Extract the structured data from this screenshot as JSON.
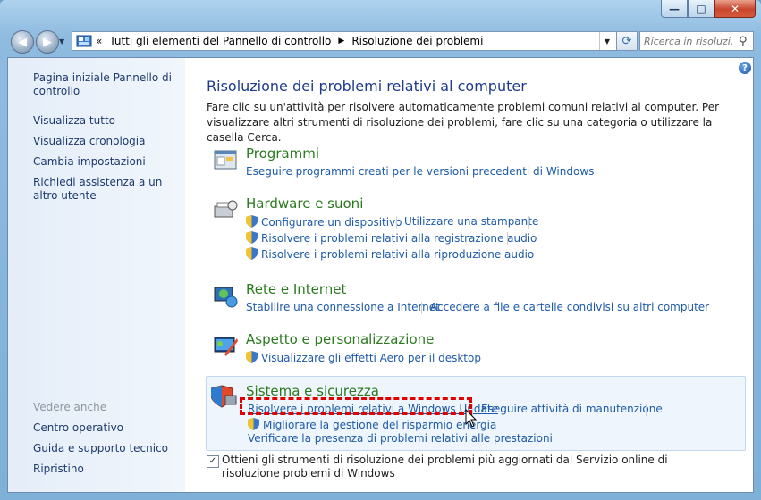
{
  "window": {
    "min_label": "—",
    "max_label": "□",
    "close_label": "✕"
  },
  "address": {
    "root_glyph": "«",
    "crumbs": [
      "Tutti gli elementi del Pannello di controllo",
      "Risoluzione dei problemi"
    ],
    "crumb_sep": "▶"
  },
  "search": {
    "placeholder": "Ricerca in risoluzi..."
  },
  "sidebar": {
    "home": "Pagina iniziale Pannello di controllo",
    "items": [
      "Visualizza tutto",
      "Visualizza cronologia",
      "Cambia impostazioni",
      "Richiedi assistenza a un altro utente"
    ],
    "see_also_header": "Vedere anche",
    "see_also": [
      "Centro operativo",
      "Guida e supporto tecnico",
      "Ripristino"
    ]
  },
  "main": {
    "title": "Risoluzione dei problemi relativi al computer",
    "intro": "Fare clic su un'attività per risolvere automaticamente problemi comuni relativi al computer. Per visualizzare altri strumenti di risoluzione dei problemi, fare clic su una categoria o utilizzare la casella Cerca.",
    "categories": [
      {
        "title": "Programmi",
        "links": [
          "Eseguire programmi creati per le versioni precedenti di Windows"
        ]
      },
      {
        "title": "Hardware e suoni",
        "links": [
          "Configurare un dispositivo",
          "Utilizzare una stampante",
          "Risolvere i problemi relativi alla registrazione audio",
          "Risolvere i problemi relativi alla riproduzione audio"
        ]
      },
      {
        "title": "Rete e Internet",
        "links": [
          "Stabilire una connessione a Internet",
          "Accedere a file e cartelle condivisi su altri computer"
        ]
      },
      {
        "title": "Aspetto e personalizzazione",
        "links": [
          "Visualizzare gli effetti Aero per il desktop"
        ]
      },
      {
        "title": "Sistema e sicurezza",
        "links": [
          "Risolvere i problemi relativi a Windows Update",
          "Eseguire attività di manutenzione",
          "Migliorare la gestione del risparmio energia",
          "Verificare la presenza di problemi relativi alle prestazioni"
        ]
      }
    ],
    "online_checkbox": {
      "checked": true,
      "label": "Ottieni gli strumenti di risoluzione dei problemi più aggiornati dal Servizio online di risoluzione problemi di Windows"
    }
  },
  "icons": {
    "back": "back-arrow-icon",
    "forward": "forward-arrow-icon",
    "refresh": "refresh-icon",
    "search": "magnifier-icon",
    "help": "help-icon",
    "shield": "uac-shield-icon"
  },
  "colors": {
    "link": "#1e5aa8",
    "category_title": "#2a7a1e",
    "title": "#1e3a8c",
    "highlight_border": "#e00000"
  }
}
